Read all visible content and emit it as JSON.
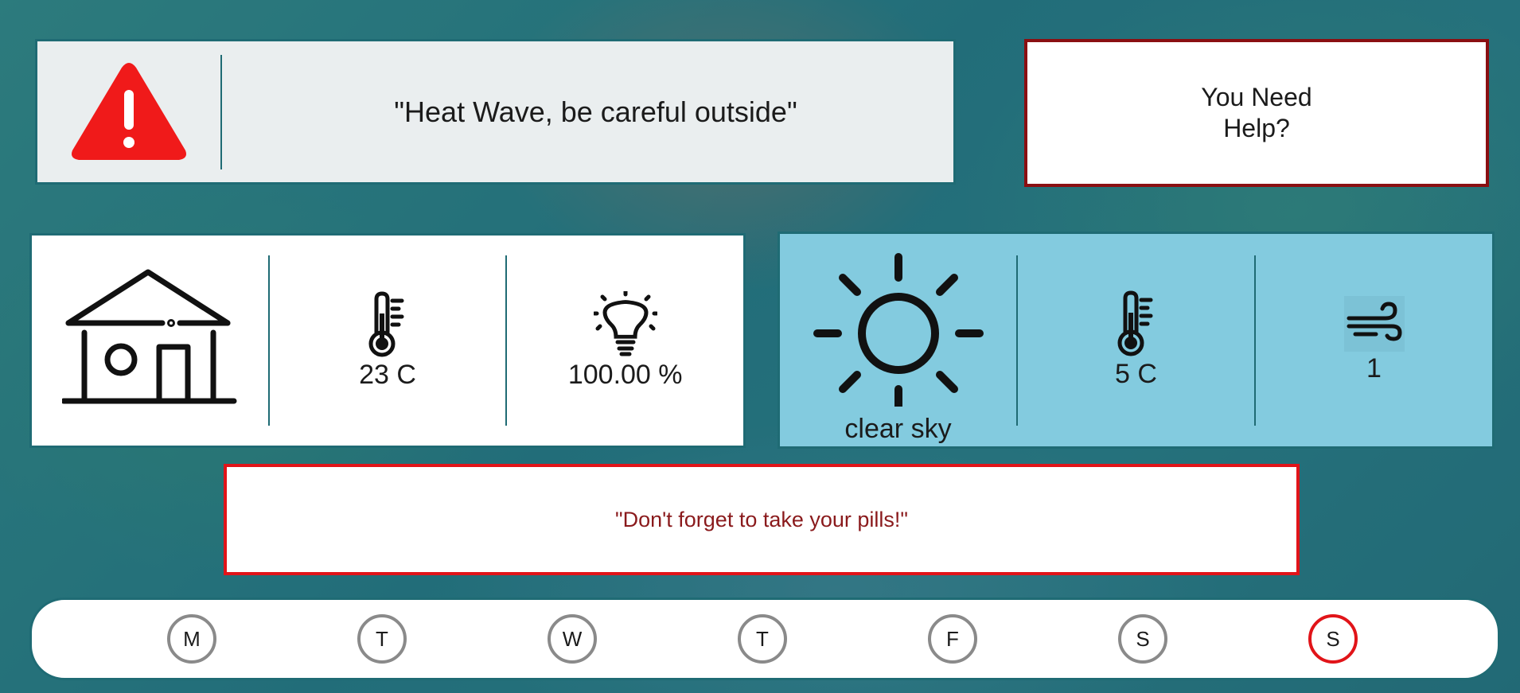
{
  "alert": {
    "icon": "warning-triangle-icon",
    "message": "\"Heat Wave, be careful outside\"",
    "icon_color": "#f01a1a"
  },
  "help": {
    "line1": "You Need",
    "line2": "Help?"
  },
  "indoor": {
    "icon": "house-icon",
    "temperature": "23 C",
    "light": "100.00 %"
  },
  "outdoor": {
    "icon": "sun-icon",
    "condition": "clear sky",
    "temperature": "5 C",
    "wind": "1"
  },
  "reminder": {
    "message": "\"Don't forget to take your pills!\""
  },
  "week": {
    "days": [
      "M",
      "T",
      "W",
      "T",
      "F",
      "S",
      "S"
    ],
    "active_index": 6
  },
  "colors": {
    "accent": "#1f6b74",
    "danger": "#e11419",
    "help_border": "#8a0f12",
    "outdoor_bg": "#83cbdf"
  }
}
